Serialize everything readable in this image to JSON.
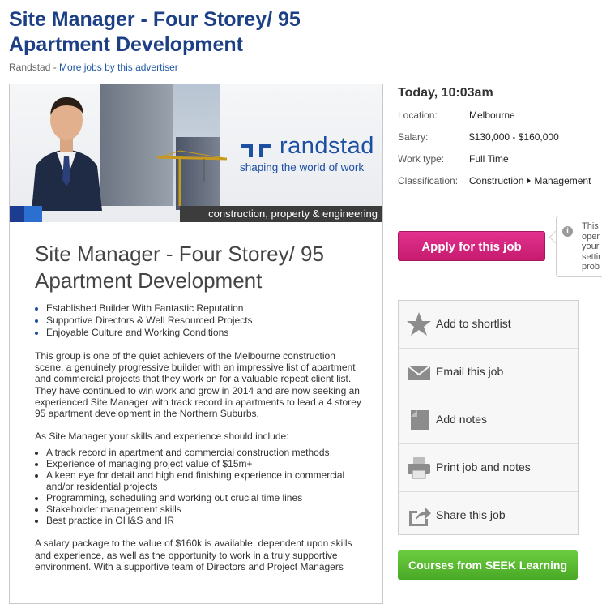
{
  "job": {
    "title": "Site Manager - Four Storey/ 95 Apartment Development",
    "advertiser": "Randstad",
    "advertiser_sep": " - ",
    "more_jobs_link": "More jobs by this advertiser"
  },
  "banner": {
    "logo_text": "randstad",
    "tagline": "shaping the world of work",
    "strip": "construction, property & engineering"
  },
  "ad": {
    "heading": "Site Manager - Four Storey/ 95 Apartment Development",
    "highlights": [
      "Established Builder With Fantastic Reputation",
      "Supportive Directors & Well Resourced Projects",
      "Enjoyable Culture and Working Conditions"
    ],
    "intro": "This group is one of the quiet achievers of the Melbourne construction scene, a genuinely progressive builder with an impressive list of apartment and commercial projects that they work on for a valuable repeat client list. They have continued to win work and grow in 2014 and are now seeking an experienced Site Manager with track record in apartments to lead a 4 storey 95 apartment development in the Northern Suburbs.",
    "skills_intro": "As Site Manager your skills and experience should include:",
    "skills": [
      "A track record in apartment and commercial construction methods",
      "Experience of managing project value of $15m+",
      "A keen eye for detail and high end finishing experience in commercial and/or residential projects",
      "Programming, scheduling and working out crucial time lines",
      "Stakeholder management skills",
      "Best practice in OH&S and IR"
    ],
    "salary_para": "A salary package to the value of $160k is available, dependent upon skills and experience, as well as the opportunity to work in a truly supportive environment. With a supportive team of Directors and Project Managers"
  },
  "sidebar": {
    "posted": "Today, 10:03am",
    "details": {
      "location_label": "Location:",
      "location": "Melbourne",
      "salary_label": "Salary:",
      "salary": "$130,000 - $160,000",
      "work_type_label": "Work type:",
      "work_type": "Full Time",
      "classification_label": "Classification:",
      "classification": "Construction",
      "sub_classification": "Management"
    },
    "apply_label": "Apply for this job",
    "tooltip_lines": [
      "This",
      "oper",
      "your",
      "settir",
      "prob"
    ],
    "actions": [
      {
        "label": "Add to shortlist",
        "icon": "star-icon"
      },
      {
        "label": "Email this job",
        "icon": "envelope-icon"
      },
      {
        "label": "Add notes",
        "icon": "note-icon"
      },
      {
        "label": "Print job and notes",
        "icon": "printer-icon"
      },
      {
        "label": "Share this job",
        "icon": "share-icon"
      }
    ],
    "courses_label": "Courses from SEEK Learning"
  },
  "colors": {
    "title": "#1c3f86",
    "link": "#1f57a4",
    "apply": "#d4267f",
    "courses": "#5bb832",
    "brand_blue": "#1d4fa3"
  }
}
